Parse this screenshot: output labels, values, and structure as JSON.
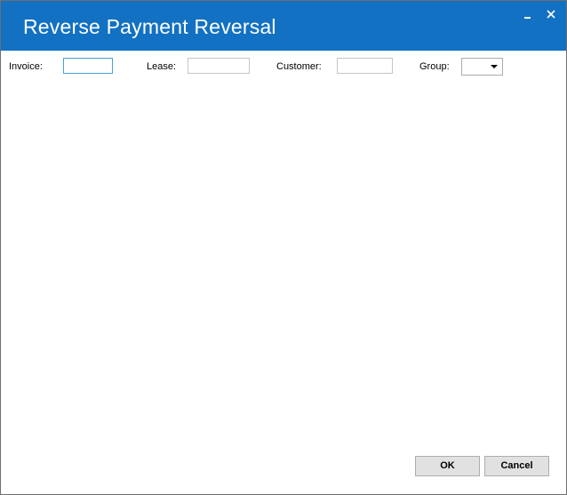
{
  "window": {
    "title": "Reverse Payment Reversal",
    "title_bar_color": "#1271c2",
    "controls": {
      "minimize_icon": "minimize-icon",
      "close_icon": "close-icon"
    }
  },
  "filters": {
    "invoice": {
      "label": "Invoice:",
      "value": ""
    },
    "lease": {
      "label": "Lease:",
      "value": ""
    },
    "customer": {
      "label": "Customer:",
      "value": ""
    },
    "group": {
      "label": "Group:",
      "selected": ""
    }
  },
  "buttons": {
    "ok_label": "OK",
    "cancel_label": "Cancel"
  }
}
